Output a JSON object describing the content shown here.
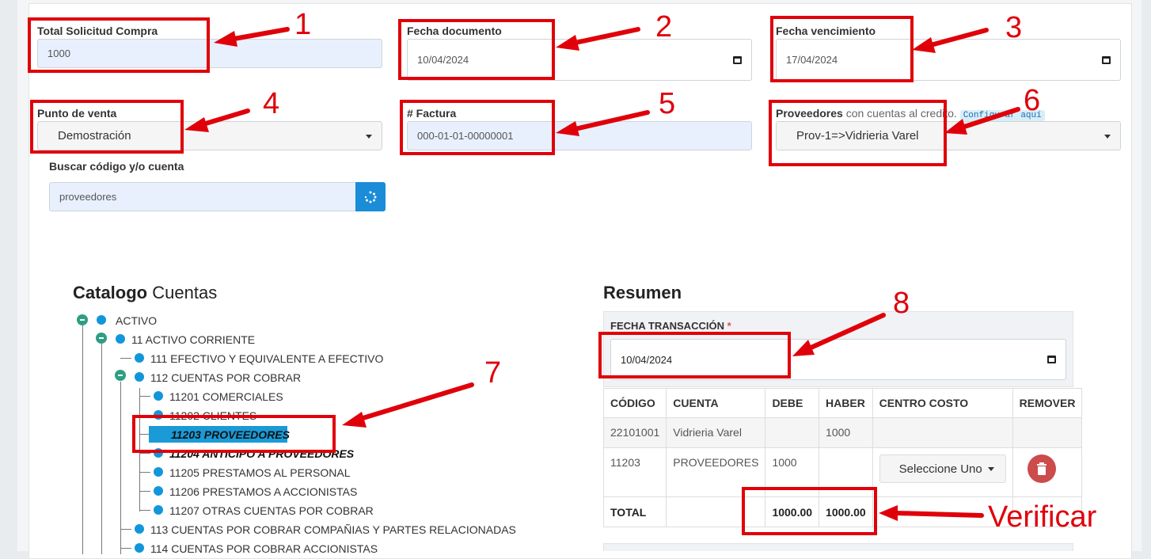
{
  "form": {
    "total_label": "Total Solicitud Compra",
    "total_value": "1000",
    "fecha_doc_label": "Fecha documento",
    "fecha_doc_value": "10/04/2024",
    "fecha_venc_label": "Fecha vencimiento",
    "fecha_venc_value": "17/04/2024",
    "punto_label": "Punto de venta",
    "punto_value": "Demostración",
    "factura_label": "# Factura",
    "factura_value": "000-01-01-00000001",
    "prov_label_bold": "Proveedores",
    "prov_label_rest": "con cuentas al credito.",
    "prov_badge": "Configurar aquí",
    "prov_value": "Prov-1=>Vidrieria Varel",
    "buscar_label": "Buscar código y/o cuenta",
    "buscar_value": "proveedores"
  },
  "catalog": {
    "title_bold": "Catalogo",
    "title_rest": "Cuentas",
    "items": [
      "ACTIVO",
      "11 ACTIVO CORRIENTE",
      "111 EFECTIVO Y EQUIVALENTE A EFECTIVO",
      "112 CUENTAS POR COBRAR",
      "11201 COMERCIALES",
      "11202 CLIENTES",
      "11203 PROVEEDORES",
      "11204 ANTICIPO A PROVEEDORES",
      "11205 PRESTAMOS AL PERSONAL",
      "11206 PRESTAMOS A ACCIONISTAS",
      "11207 OTRAS CUENTAS POR COBRAR",
      "113 CUENTAS POR COBRAR COMPAÑIAS Y PARTES RELACIONADAS",
      "114 CUENTAS POR COBRAR ACCIONISTAS"
    ]
  },
  "resumen": {
    "title": "Resumen",
    "fecha_label": "FECHA TRANSACCIÓN",
    "required_mark": "*",
    "fecha_value": "10/04/2024",
    "headers": [
      "CÓDIGO",
      "CUENTA",
      "DEBE",
      "HABER",
      "CENTRO COSTO",
      "REMOVER"
    ],
    "rows": [
      {
        "codigo": "22101001",
        "cuenta": "Vidrieria Varel",
        "debe": "",
        "haber": "1000"
      },
      {
        "codigo": "11203",
        "cuenta": "PROVEEDORES",
        "debe": "1000",
        "haber": "",
        "centro": "Seleccione Uno"
      }
    ],
    "total_label": "TOTAL",
    "total_debe": "1000.00",
    "total_haber": "1000.00"
  },
  "annotations": {
    "n1": "1",
    "n2": "2",
    "n3": "3",
    "n4": "4",
    "n5": "5",
    "n6": "6",
    "n7": "7",
    "n8": "8",
    "verificar": "Verificar",
    "color": "#e0000a"
  }
}
